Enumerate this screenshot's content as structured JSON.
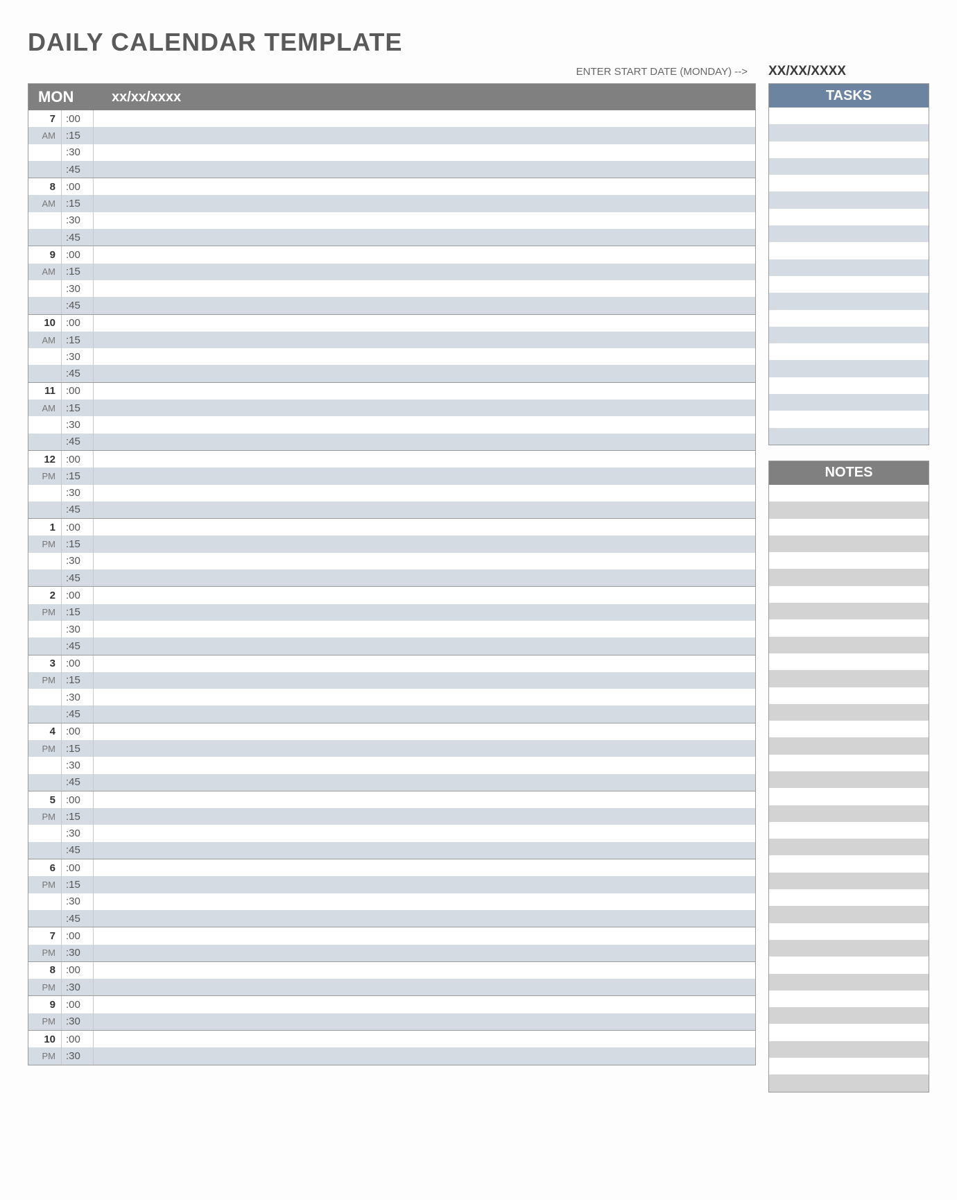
{
  "title": "DAILY CALENDAR TEMPLATE",
  "start_date": {
    "label": "ENTER START DATE (MONDAY) -->",
    "value": "XX/XX/XXXX"
  },
  "calendar": {
    "day_label": "MON",
    "date_value": "xx/xx/xxxx",
    "hours": [
      {
        "hour": "7",
        "ampm": "AM",
        "minutes": [
          ":00",
          ":15",
          ":30",
          ":45"
        ],
        "alt": [
          false,
          true,
          false,
          true
        ]
      },
      {
        "hour": "8",
        "ampm": "AM",
        "minutes": [
          ":00",
          ":15",
          ":30",
          ":45"
        ],
        "alt": [
          false,
          true,
          false,
          true
        ]
      },
      {
        "hour": "9",
        "ampm": "AM",
        "minutes": [
          ":00",
          ":15",
          ":30",
          ":45"
        ],
        "alt": [
          false,
          true,
          false,
          true
        ]
      },
      {
        "hour": "10",
        "ampm": "AM",
        "minutes": [
          ":00",
          ":15",
          ":30",
          ":45"
        ],
        "alt": [
          false,
          true,
          false,
          true
        ]
      },
      {
        "hour": "11",
        "ampm": "AM",
        "minutes": [
          ":00",
          ":15",
          ":30",
          ":45"
        ],
        "alt": [
          false,
          true,
          false,
          true
        ]
      },
      {
        "hour": "12",
        "ampm": "PM",
        "minutes": [
          ":00",
          ":15",
          ":30",
          ":45"
        ],
        "alt": [
          false,
          true,
          false,
          true
        ]
      },
      {
        "hour": "1",
        "ampm": "PM",
        "minutes": [
          ":00",
          ":15",
          ":30",
          ":45"
        ],
        "alt": [
          false,
          true,
          false,
          true
        ]
      },
      {
        "hour": "2",
        "ampm": "PM",
        "minutes": [
          ":00",
          ":15",
          ":30",
          ":45"
        ],
        "alt": [
          false,
          true,
          false,
          true
        ]
      },
      {
        "hour": "3",
        "ampm": "PM",
        "minutes": [
          ":00",
          ":15",
          ":30",
          ":45"
        ],
        "alt": [
          false,
          true,
          false,
          true
        ]
      },
      {
        "hour": "4",
        "ampm": "PM",
        "minutes": [
          ":00",
          ":15",
          ":30",
          ":45"
        ],
        "alt": [
          false,
          true,
          false,
          true
        ]
      },
      {
        "hour": "5",
        "ampm": "PM",
        "minutes": [
          ":00",
          ":15",
          ":30",
          ":45"
        ],
        "alt": [
          false,
          true,
          false,
          true
        ]
      },
      {
        "hour": "6",
        "ampm": "PM",
        "minutes": [
          ":00",
          ":15",
          ":30",
          ":45"
        ],
        "alt": [
          false,
          true,
          false,
          true
        ]
      },
      {
        "hour": "7",
        "ampm": "PM",
        "minutes": [
          ":00",
          ":30"
        ],
        "alt": [
          false,
          true
        ]
      },
      {
        "hour": "8",
        "ampm": "PM",
        "minutes": [
          ":00",
          ":30"
        ],
        "alt": [
          false,
          true
        ]
      },
      {
        "hour": "9",
        "ampm": "PM",
        "minutes": [
          ":00",
          ":30"
        ],
        "alt": [
          false,
          true
        ]
      },
      {
        "hour": "10",
        "ampm": "PM",
        "minutes": [
          ":00",
          ":30"
        ],
        "alt": [
          false,
          true
        ]
      }
    ]
  },
  "tasks": {
    "header": "TASKS",
    "rows": 20
  },
  "notes": {
    "header": "NOTES",
    "rows": 36
  }
}
